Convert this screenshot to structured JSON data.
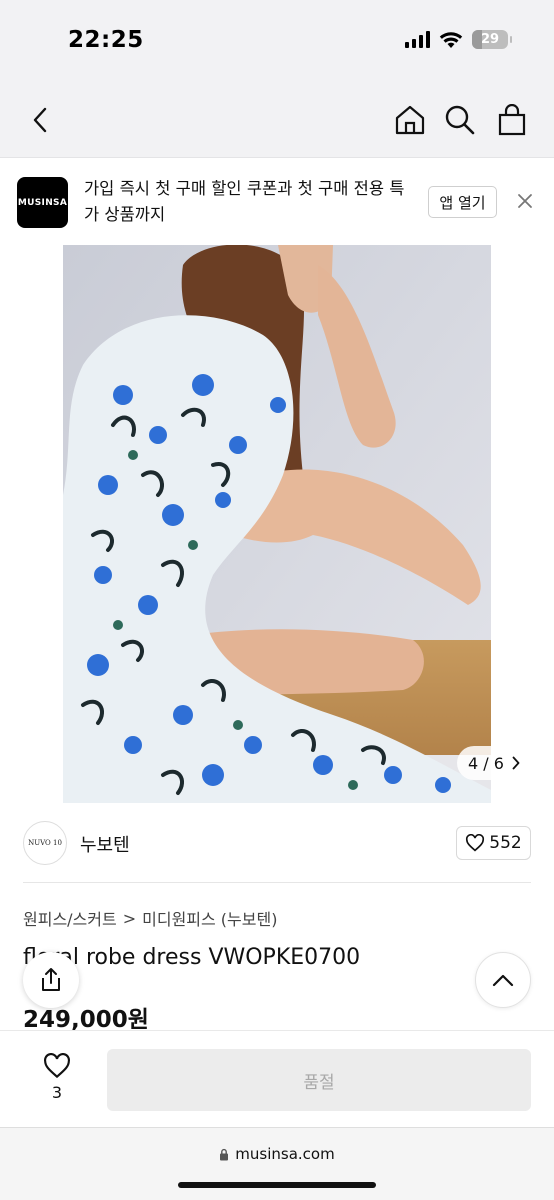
{
  "status_bar": {
    "time": "22:25",
    "battery": "29",
    "battery_level": 0.29
  },
  "banner": {
    "logo_text": "MUSINSA",
    "message": "가입 즉시 첫 구매 할인 쿠폰과 첫 구매 전용 특가 상품까지",
    "open_app_label": "앱 열기"
  },
  "image_counter": {
    "text": "4 / 6"
  },
  "brand": {
    "logo_text": "NUVO 10",
    "name": "누보텐",
    "likes": "552"
  },
  "breadcrumb": {
    "category": "원피스/스커트",
    "separator": ">",
    "subcategory": "미디원피스 (누보텐)"
  },
  "product": {
    "title": "floral robe dress VWOPKE0700",
    "price": "249,000원"
  },
  "bottom_bar": {
    "wish_count": "3",
    "soldout_label": "품절"
  },
  "browser": {
    "url": "musinsa.com"
  },
  "colors": {
    "accent_blue": "#2f6fd6",
    "soldout_bg": "#ececec",
    "soldout_text": "#a8a8a8"
  }
}
